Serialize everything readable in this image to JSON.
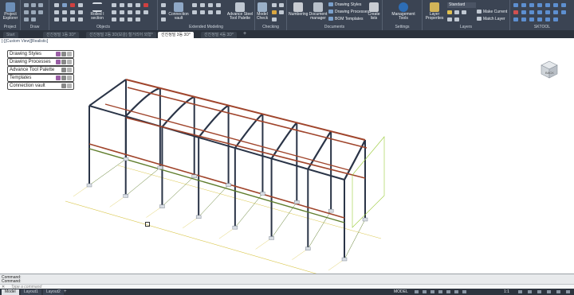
{
  "ribbon": {
    "groups": [
      {
        "label": "Project"
      },
      {
        "label": "Draw"
      },
      {
        "label": "Objects"
      },
      {
        "label": "Extended Modeling"
      },
      {
        "label": "Checking"
      },
      {
        "label": "Documents"
      },
      {
        "label": "Settings"
      },
      {
        "label": "Layers"
      },
      {
        "label": "SKTOOL"
      }
    ],
    "project_explorer": "Project Explorer",
    "rolled_section": "Rolled I section",
    "connection_vault": "Connection vault",
    "advance_steel_tool_palette": "Advance Steel Tool Palette",
    "model_check": "Model Check",
    "numbering": "Numbering",
    "document_manager": "Document manager",
    "drawing_styles": "Drawing Styles",
    "drawing_processes": "Drawing Processes",
    "bom_templates": "BOM Templates",
    "create_lists": "Create lists",
    "management_tools": "Management Tools",
    "layer_properties": "Layer Properties",
    "layer_standard": "Standard",
    "make_current": "Make Current",
    "match_layer": "Match Layer"
  },
  "tabs": [
    {
      "label": "Start",
      "active": false
    },
    {
      "label": "선진정밀 1동 3D*",
      "active": false
    },
    {
      "label": "선진정밀 2동 3D(보강) 철거리어 외형*",
      "active": false
    },
    {
      "label": "선진정밀 3동 3D*",
      "active": true
    },
    {
      "label": "선진정밀 4동 3D*",
      "active": false
    }
  ],
  "viewport": {
    "label": "[-][Custom View][Realistic]"
  },
  "palettes": [
    {
      "label": "Drawing Styles"
    },
    {
      "label": "Drawing Processes"
    },
    {
      "label": "Advance Tool Palette"
    },
    {
      "label": "Templates"
    },
    {
      "label": "Connection vault"
    }
  ],
  "viewcube": {
    "face": "BACK"
  },
  "command": {
    "history": [
      "Command:",
      "Command:"
    ],
    "prompt": "Type a command"
  },
  "status": {
    "layouts": [
      {
        "label": "Model",
        "active": true
      },
      {
        "label": "Layout1",
        "active": false
      },
      {
        "label": "Layout2",
        "active": false
      }
    ],
    "space": "MODEL",
    "scale": "1:1"
  },
  "colors": {
    "ribbon_bg": "#3b4453",
    "steel_frame": "#2a3447",
    "beam_red": "#a0452c",
    "beam_green": "#5f7d2c",
    "dim_yellow": "#d9c64a"
  }
}
